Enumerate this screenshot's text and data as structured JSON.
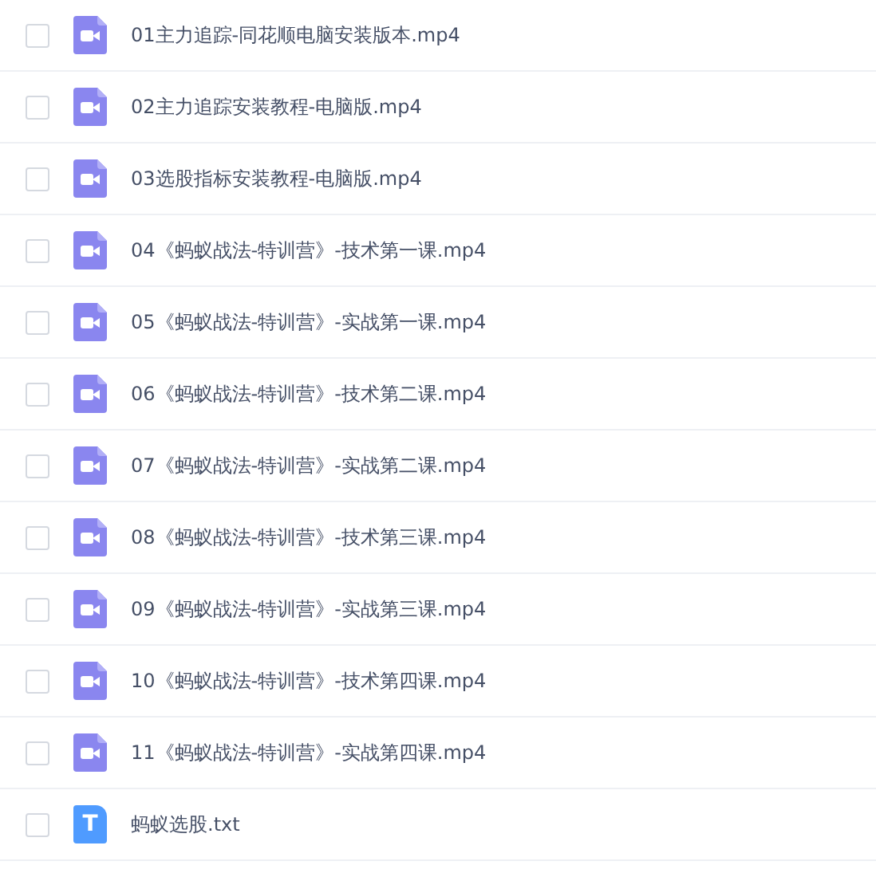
{
  "files": [
    {
      "name": "01主力追踪-同花顺电脑安装版本.mp4",
      "kind": "video",
      "checked": false
    },
    {
      "name": "02主力追踪安装教程-电脑版.mp4",
      "kind": "video",
      "checked": false
    },
    {
      "name": "03选股指标安装教程-电脑版.mp4",
      "kind": "video",
      "checked": false
    },
    {
      "name": "04《蚂蚁战法-特训营》-技术第一课.mp4",
      "kind": "video",
      "checked": false
    },
    {
      "name": "05《蚂蚁战法-特训营》-实战第一课.mp4",
      "kind": "video",
      "checked": false
    },
    {
      "name": "06《蚂蚁战法-特训营》-技术第二课.mp4",
      "kind": "video",
      "checked": false
    },
    {
      "name": "07《蚂蚁战法-特训营》-实战第二课.mp4",
      "kind": "video",
      "checked": false
    },
    {
      "name": "08《蚂蚁战法-特训营》-技术第三课.mp4",
      "kind": "video",
      "checked": false
    },
    {
      "name": "09《蚂蚁战法-特训营》-实战第三课.mp4",
      "kind": "video",
      "checked": false
    },
    {
      "name": "10《蚂蚁战法-特训营》-技术第四课.mp4",
      "kind": "video",
      "checked": false
    },
    {
      "name": "11《蚂蚁战法-特训营》-实战第四课.mp4",
      "kind": "video",
      "checked": false
    },
    {
      "name": "蚂蚁选股.txt",
      "kind": "text",
      "checked": false,
      "icon_text": "T"
    }
  ]
}
